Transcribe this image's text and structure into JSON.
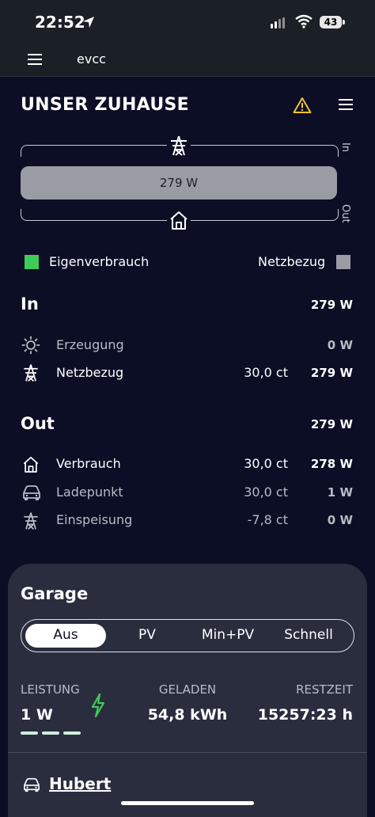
{
  "status_bar": {
    "time": "22:52",
    "battery": "43"
  },
  "app_bar": {
    "title": "evcc"
  },
  "site": {
    "title": "UNSER ZUHAUSE"
  },
  "flow": {
    "bar_value": "279 W",
    "in_label": "In",
    "out_label": "Out"
  },
  "legend": {
    "self_consumption": "Eigenverbrauch",
    "grid_import": "Netzbezug",
    "self_color": "#3ecb5a",
    "grid_color": "#9a9ca4"
  },
  "in_section": {
    "title": "In",
    "total": "279 W",
    "rows": [
      {
        "icon": "sun-icon",
        "label": "Erzeugung",
        "price": "",
        "value": "0 W",
        "active": false
      },
      {
        "icon": "power-tower-icon",
        "label": "Netzbezug",
        "price": "30,0 ct",
        "value": "279 W",
        "active": true
      }
    ]
  },
  "out_section": {
    "title": "Out",
    "total": "279 W",
    "rows": [
      {
        "icon": "house-icon",
        "label": "Verbrauch",
        "price": "30,0 ct",
        "value": "278 W",
        "active": true
      },
      {
        "icon": "car-icon",
        "label": "Ladepunkt",
        "price": "30,0 ct",
        "value": "1 W",
        "active": false
      },
      {
        "icon": "power-tower-icon",
        "label": "Einspeisung",
        "price": "-7,8 ct",
        "value": "0 W",
        "active": false
      }
    ]
  },
  "garage": {
    "title": "Garage",
    "modes": [
      "Aus",
      "PV",
      "Min+PV",
      "Schnell"
    ],
    "selected_mode": "Aus",
    "power_label": "LEISTUNG",
    "power_value": "1 W",
    "charged_label": "GELADEN",
    "charged_value": "54,8 kWh",
    "remaining_label": "RESTZEIT",
    "remaining_value": "15257:23 h",
    "vehicle": "Hubert",
    "accent": "#3ecb5a"
  }
}
